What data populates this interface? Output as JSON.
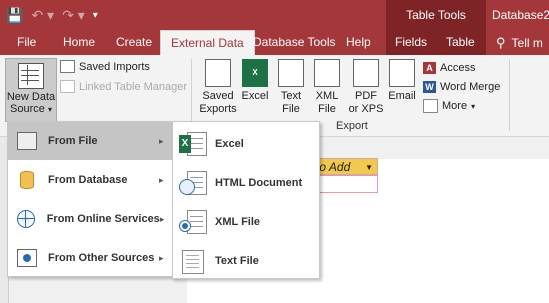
{
  "window": {
    "quick_access": {
      "save_icon": "save-icon",
      "undo_icon": "undo-icon",
      "redo_icon": "redo-icon",
      "customize_icon": "customize-qat-icon"
    },
    "context_tools": "Table Tools",
    "doc_title": "Database2 :"
  },
  "tabs": [
    "File",
    "Home",
    "Create",
    "External Data",
    "Database Tools",
    "Help",
    "Fields",
    "Table"
  ],
  "active_tab": "External Data",
  "tell_me": "Tell m",
  "ribbon": {
    "import": {
      "new_data_source_line1": "New Data",
      "new_data_source_line2": "Source",
      "saved_imports": "Saved Imports",
      "linked_table_manager": "Linked Table Manager"
    },
    "export": {
      "saved_exports_line1": "Saved",
      "saved_exports_line2": "Exports",
      "excel": "Excel",
      "text_file_line1": "Text",
      "text_file_line2": "File",
      "xml_file_line1": "XML",
      "xml_file_line2": "File",
      "pdf_line1": "PDF",
      "pdf_line2": "or XPS",
      "email": "Email",
      "access": "Access",
      "word_merge": "Word Merge",
      "more": "More",
      "group_label": "Export"
    }
  },
  "new_data_menu": [
    {
      "label": "From File",
      "icon": "file-source-icon"
    },
    {
      "label": "From Database",
      "icon": "database-icon"
    },
    {
      "label": "From Online Services",
      "icon": "globe-icon"
    },
    {
      "label": "From Other Sources",
      "icon": "other-sources-icon"
    }
  ],
  "from_file_submenu": [
    {
      "label": "Excel",
      "icon": "excel-icon"
    },
    {
      "label": "HTML Document",
      "icon": "html-document-icon"
    },
    {
      "label": "XML File",
      "icon": "xml-file-icon"
    },
    {
      "label": "Text File",
      "icon": "text-file-icon"
    }
  ],
  "datasheet": {
    "column_header": "to Add"
  },
  "colors": {
    "access_accent": "#a4373a",
    "context_accent": "#7e2426",
    "column_header_highlight": "#f2c94c",
    "excel_green": "#1e7145"
  }
}
